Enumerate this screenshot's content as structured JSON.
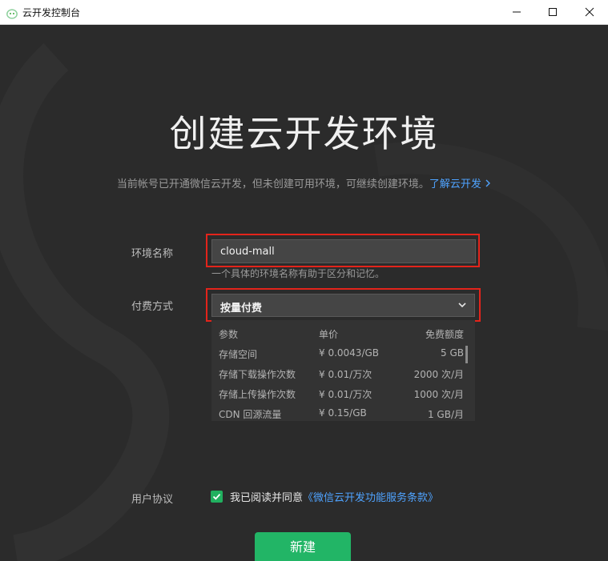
{
  "window": {
    "title": "云开发控制台",
    "icon": "cloud-dev-logo-icon",
    "controls": [
      "minimize-icon",
      "maximize-icon",
      "close-icon"
    ]
  },
  "page": {
    "heading": "创建云开发环境",
    "subtitle": "当前帐号已开通微信云开发，但未创建可用环境，可继续创建环境。",
    "learn_more": "了解云开发",
    "learn_more_icon": "chevron-right-icon"
  },
  "form": {
    "env_name": {
      "label": "环境名称",
      "value": "cloud-mall",
      "hint": "一个具体的环境名称有助于区分和记忆。"
    },
    "payment": {
      "label": "付费方式",
      "selected": "按量付费",
      "icon": "chevron-down-icon"
    },
    "pricing_table": {
      "headers": [
        "参数",
        "单价",
        "免费额度"
      ],
      "rows": [
        [
          "存储空间",
          "¥ 0.0043/GB",
          "5 GB"
        ],
        [
          "存储下载操作次数",
          "¥ 0.01/万次",
          "2000 次/月"
        ],
        [
          "存储上传操作次数",
          "¥ 0.01/万次",
          "1000 次/月"
        ],
        [
          "CDN 回源流量",
          "¥ 0.15/GB",
          "1 GB/月"
        ]
      ]
    },
    "agreement": {
      "label": "用户协议",
      "checked": true,
      "text": "我已阅读并同意",
      "link": "《微信云开发功能服务条款》"
    },
    "submit_label": "新建"
  },
  "colors": {
    "background": "#2b2b2b",
    "highlight_red": "#e3241b",
    "accent_green": "#22b566",
    "link_blue": "#4fa3ff"
  }
}
